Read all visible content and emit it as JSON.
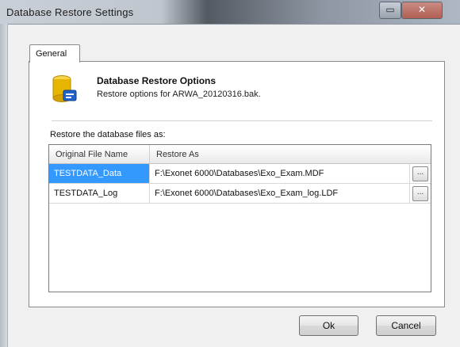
{
  "window": {
    "title": "Database Restore Settings",
    "minimize_glyph": "▭",
    "close_glyph": "✕"
  },
  "tabs": [
    {
      "label": "General",
      "selected": true
    }
  ],
  "header": {
    "icon": "database-icon",
    "title": "Database Restore Options",
    "subtitle": "Restore options for ARWA_20120316.bak."
  },
  "restore_section": {
    "label": "Restore the database files as:"
  },
  "grid": {
    "columns": [
      "Original File Name",
      "Restore As"
    ],
    "rows": [
      {
        "original": "TESTDATA_Data",
        "restore_as": "F:\\Exonet 6000\\Databases\\Exo_Exam.MDF",
        "browse_label": "...",
        "selected": true
      },
      {
        "original": "TESTDATA_Log",
        "restore_as": "F:\\Exonet 6000\\Databases\\Exo_Exam_log.LDF",
        "browse_label": "...",
        "selected": false
      }
    ]
  },
  "buttons": {
    "ok_label": "Ok",
    "cancel_label": "Cancel"
  },
  "colors": {
    "selection": "#3399ff",
    "icon_gold": "#e7b400",
    "icon_blue": "#1f63c8"
  }
}
